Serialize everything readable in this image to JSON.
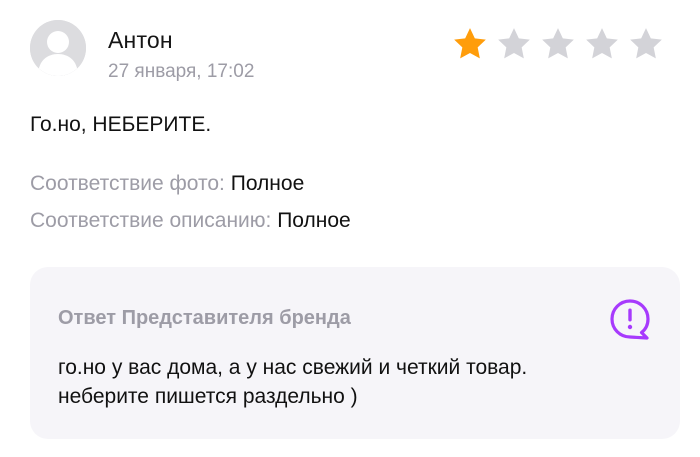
{
  "review": {
    "author": {
      "name": "Антон",
      "avatar_icon": "user-avatar-icon"
    },
    "date": "27 января, 17:02",
    "rating": {
      "value": 1,
      "max": 5,
      "filled_color": "#ff9d0b",
      "empty_color": "#d3d3d8"
    },
    "text": "Го.но, НЕБЕРИТЕ.",
    "attributes": [
      {
        "label": "Соответствие фото:",
        "value": "Полное"
      },
      {
        "label": "Соответствие описанию:",
        "value": "Полное"
      }
    ]
  },
  "reply": {
    "title": "Ответ Представителя бренда",
    "icon": "exclamation-chat-icon",
    "icon_color": "#a73afd",
    "lines": [
      "го.но у вас дома, а у нас свежий и четкий товар.",
      "неберите пишется раздельно )"
    ]
  }
}
